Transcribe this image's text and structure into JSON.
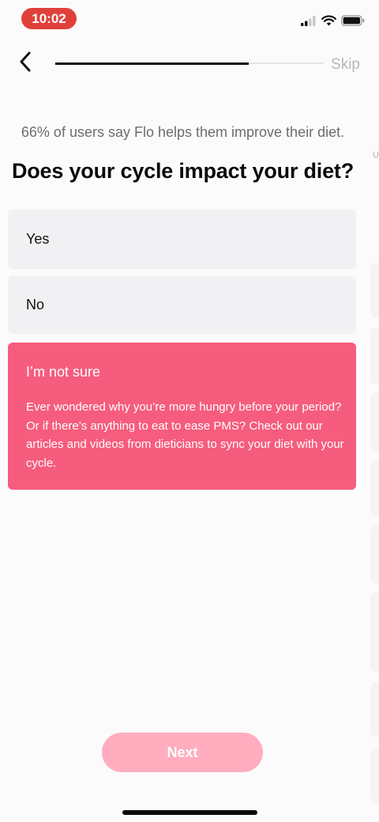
{
  "status_bar": {
    "time": "10:02",
    "icons": [
      "signal-icon",
      "wifi-icon",
      "battery-icon"
    ]
  },
  "nav": {
    "back_icon": "chevron-left-icon",
    "progress": 0.72,
    "skip_label": "Skip"
  },
  "subtitle": "66% of users say Flo helps them improve their diet.",
  "question": "Does your cycle impact your diet?",
  "options": [
    {
      "label": "Yes",
      "selected": false
    },
    {
      "label": "No",
      "selected": false
    },
    {
      "label": "I’m not sure",
      "selected": true,
      "description": "Ever wondered why you’re more hungry before your period? Or if there’s anything to eat to ease PMS? Check out our articles and videos from dieticians to sync your diet with your cycle."
    }
  ],
  "edge_peek_letter": "U",
  "next_label": "Next",
  "colors": {
    "accent": "#f65c7d",
    "next_disabled": "#ffadbf",
    "option_bg": "#f1f0f2",
    "time_pill": "#e0403a"
  }
}
